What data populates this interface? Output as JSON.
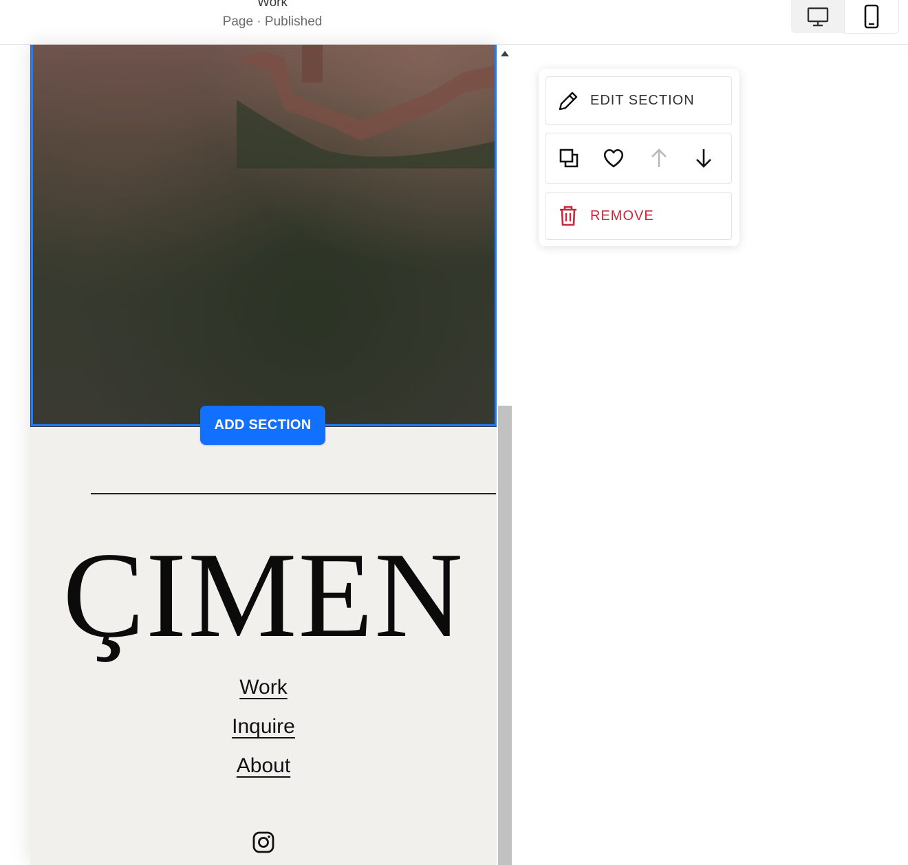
{
  "header": {
    "page_title": "Work",
    "page_status": "Page · Published",
    "view_toggle": [
      {
        "icon": "desktop-icon",
        "active": false
      },
      {
        "icon": "mobile-icon",
        "active": true
      }
    ]
  },
  "section_toolbar": {
    "edit_label": "EDIT SECTION",
    "remove_label": "REMOVE",
    "actions": [
      "duplicate-icon",
      "heart-icon",
      "arrow-up-icon",
      "arrow-down-icon"
    ],
    "remove_color": "#c8283a"
  },
  "add_section": {
    "label": "ADD SECTION",
    "color": "#1270ff"
  },
  "site_footer": {
    "brand": "ÇIMEN",
    "nav": [
      "Work",
      "Inquire",
      "About"
    ],
    "social_icon": "instagram-icon",
    "background": "#f1f0ec"
  },
  "accent_color": "#1f7bff"
}
